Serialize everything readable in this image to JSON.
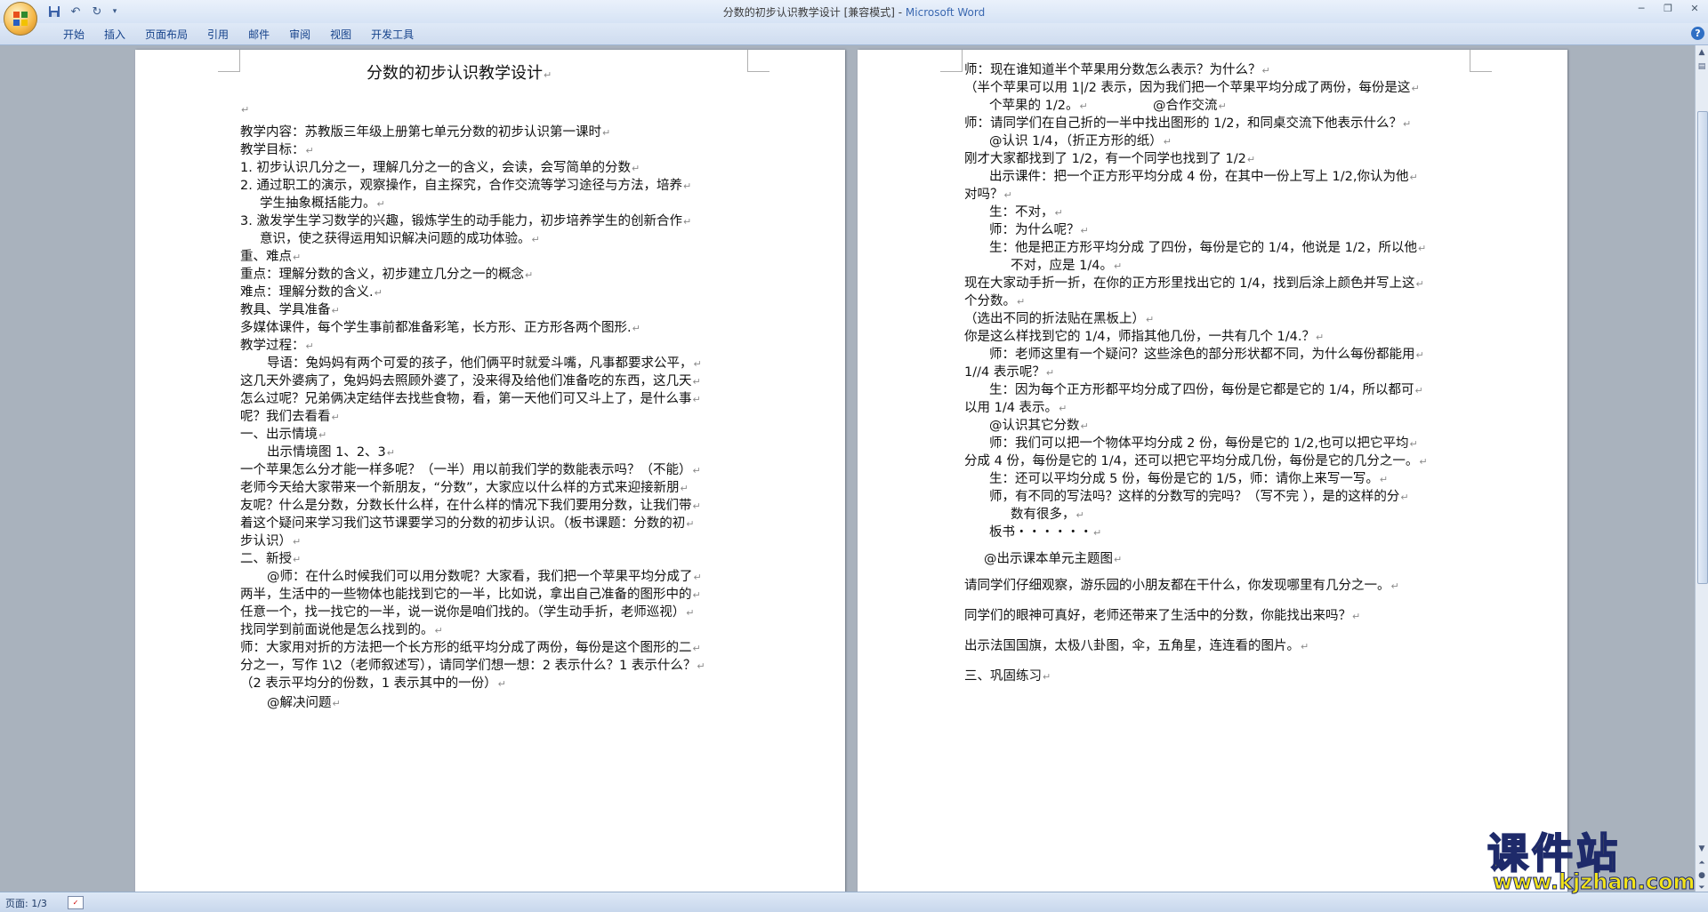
{
  "window": {
    "title": "分数的初步认识教学设计 [兼容模式] - ",
    "app": "Microsoft Word"
  },
  "ribbon": {
    "tabs": [
      "开始",
      "插入",
      "页面布局",
      "引用",
      "邮件",
      "审阅",
      "视图",
      "开发工具"
    ]
  },
  "page1": {
    "lines": [
      "分数的初步认识教学设计",
      "",
      "教学内容：苏教版三年级上册第七单元分数的初步认识第一课时",
      "教学目标：",
      "1.   初步认识几分之一，理解几分之一的含义，会读，会写简单的分数",
      "2.   通过职工的演示，观察操作，自主探究，合作交流等学习途径与方法，培养",
      "学生抽象概括能力。",
      "3.   激发学生学习数学的兴趣，锻炼学生的动手能力，初步培养学生的创新合作",
      "意识，使之获得运用知识解决问题的成功体验。",
      "重、难点",
      "重点：理解分数的含义，初步建立几分之一的概念",
      "难点：理解分数的含义.",
      "教具、学具准备",
      "多媒体课件，每个学生事前都准备彩笔，长方形、正方形各两个图形.",
      "教学过程：",
      "导语：兔妈妈有两个可爱的孩子，他们俩平时就爱斗嘴，凡事都要求公平，",
      "这几天外婆病了，兔妈妈去照顾外婆了，没来得及给他们准备吃的东西，这几天",
      "怎么过呢？兄弟俩决定结伴去找些食物，看，第一天他们可又斗上了，是什么事",
      "呢？我们去看看",
      "一、出示情境",
      "出示情境图 1、2、3",
      "一个苹果怎么分才能一样多呢？（一半）用以前我们学的数能表示吗？（不能）",
      "老师今天给大家带来一个新朋友，“分数”，大家应以什么样的方式来迎接新朋",
      "友呢？什么是分数，分数长什么样，在什么样的情况下我们要用分数，让我们带",
      "着这个疑问来学习我们这节课要学习的分数的初步认识。（板书课题：分数的初",
      "步认识）",
      "二、新授",
      "@师：在什么时候我们可以用分数呢？大家看，我们把一个苹果平均分成了",
      "两半，生活中的一些物体也能找到它的一半，比如说，拿出自己准备的图形中的",
      "任意一个，找一找它的一半，说一说你是咱们找的。（学生动手折，老师巡视）",
      "找同学到前面说他是怎么找到的。",
      "师：大家用对折的方法把一个长方形的纸平均分成了两份，每份是这个图形的二",
      "分之一，写作 1\\2（老师叙述写），请同学们想一想：2 表示什么？1 表示什么？",
      "（2 表示平均分的份数，1 表示其中的一份）",
      "@解决问题"
    ]
  },
  "page2": {
    "lines": [
      "师：现在谁知道半个苹果用分数怎么表示？为什么？",
      "（半个苹果可以用 1|/2 表示，因为我们把一个苹果平均分成了两份，每份是这",
      "个苹果的 1/2。",
      "@合作交流",
      "师：请同学们在自己折的一半中找出图形的 1/2，和同桌交流下他表示什么？",
      "@认识 1/4，（折正方形的纸）",
      "刚才大家都找到了 1/2，有一个同学也找到了 1/2",
      "出示课件：把一个正方形平均分成 4 份，在其中一份上写上 1/2,你认为他",
      "对吗？",
      "生：不对，",
      "师：为什么呢？",
      "生：他是把正方形平均分成 了四份，每份是它的 1/4，他说是 1/2，所以他",
      "不对，应是 1/4。",
      "现在大家动手折一折，在你的正方形里找出它的 1/4，找到后涂上颜色并写上这",
      "个分数。",
      "（选出不同的折法贴在黑板上）",
      "你是这么样找到它的 1/4，师指其他几份，一共有几个 1/4.？",
      "师：老师这里有一个疑问？这些涂色的部分形状都不同，为什么每份都能用",
      "1//4 表示呢？",
      "生：因为每个正方形都平均分成了四份，每份是它都是它的 1/4，所以都可",
      "以用 1/4 表示。",
      "@认识其它分数",
      "师：我们可以把一个物体平均分成 2 份，每份是它的 1/2,也可以把它平均",
      "分成 4 份，每份是它的 1/4，还可以把它平均分成几份，每份是它的几分之一。",
      "生：还可以平均分成 5 份，每份是它的 1/5，师：请你上来写一写。",
      "师，有不同的写法吗？这样的分数写的完吗？（写不完 ），是的这样的分",
      "数有很多，",
      "板书・・・・・・",
      "@出示课本单元主题图",
      "请同学们仔细观察，游乐园的小朋友都在干什么，你发现哪里有几分之一。",
      "同学们的眼神可真好，老师还带来了生活中的分数，你能找出来吗？",
      "出示法国国旗，太极八卦图，伞，五角星，连连看的图片。",
      "三、巩固练习"
    ]
  },
  "status": {
    "page_count": "页面: 1/3"
  },
  "watermark": {
    "cn": "课件站",
    "url": "www.kjzhan.com"
  }
}
